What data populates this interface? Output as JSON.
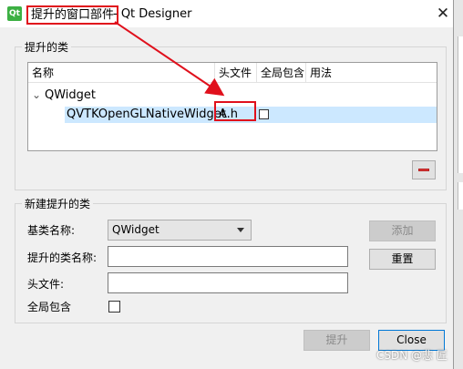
{
  "window": {
    "title_highlighted": "提升的窗口部件",
    "title_suffix": "- Qt Designer",
    "app_icon": "qt-designer-icon",
    "close_icon": "close-icon"
  },
  "promoted_group": {
    "title": "提升的类",
    "columns": [
      "名称",
      "头文件",
      "全局包含",
      "用法"
    ],
    "rows": [
      {
        "name": "QWidget",
        "expanded": true
      },
      {
        "name": "QVTKOpenGLNativeWidget",
        "header": "A.h",
        "global_include": false,
        "selected": true
      }
    ],
    "remove_button_icon": "minus-icon"
  },
  "new_group": {
    "title": "新建提升的类",
    "base_class_label": "基类名称:",
    "base_class_value": "QWidget",
    "class_name_label": "提升的类名称:",
    "class_name_value": "",
    "header_label": "头文件:",
    "header_value": "",
    "global_include_label": "全局包含",
    "global_include_checked": false,
    "add_button": "添加",
    "reset_button": "重置"
  },
  "footer": {
    "promote_button": "提升",
    "close_button": "Close"
  },
  "watermark": "CSDN @悲 匠",
  "annotation_color": "#e0101c"
}
